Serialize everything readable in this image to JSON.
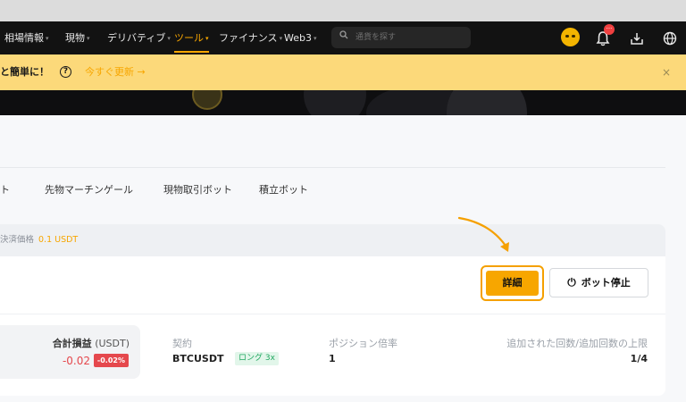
{
  "nav": {
    "items": [
      {
        "label": "相場情報",
        "caret": "▾"
      },
      {
        "label": "現物",
        "caret": "▾"
      },
      {
        "label": "デリバティブ",
        "caret": "▾"
      },
      {
        "label": "ツール",
        "caret": "▾"
      },
      {
        "label": "ファイナンス",
        "caret": "▾"
      },
      {
        "label": "Web3",
        "caret": "▾"
      }
    ],
    "active_index": 3,
    "search_placeholder": "通貨を探す",
    "notification_badge": "···",
    "icons": [
      "user-avatar",
      "bell-icon",
      "download-icon",
      "globe-icon"
    ]
  },
  "banner": {
    "message": "と簡単に！",
    "help": "?",
    "link": "今すぐ更新 →",
    "close": "×"
  },
  "tabs": [
    {
      "label": "ト"
    },
    {
      "label": "先物マーチンゲール"
    },
    {
      "label": "現物取引ボット"
    },
    {
      "label": "積立ボット"
    }
  ],
  "card": {
    "header_label": "決済価格",
    "header_value": "0.1 USDT",
    "detail_button": "詳細",
    "stop_button": "ボット停止",
    "pnl_label": "合計損益",
    "pnl_unit": "(USDT)",
    "pnl_value": "-0.02",
    "pnl_percent": "-0.02%",
    "contract_label": "契約",
    "contract_value": "BTCUSDT",
    "direction_tag": "ロング 3x",
    "leverage_label": "ポジション倍率",
    "leverage_value": "1",
    "adds_label": "追加された回数/追加回数の上限",
    "adds_value": "1/4"
  },
  "colors": {
    "accent": "#f7a600",
    "loss": "#e5484d",
    "long": "#22a861",
    "nav_bg": "#121212",
    "banner_bg": "#fcd97a"
  }
}
